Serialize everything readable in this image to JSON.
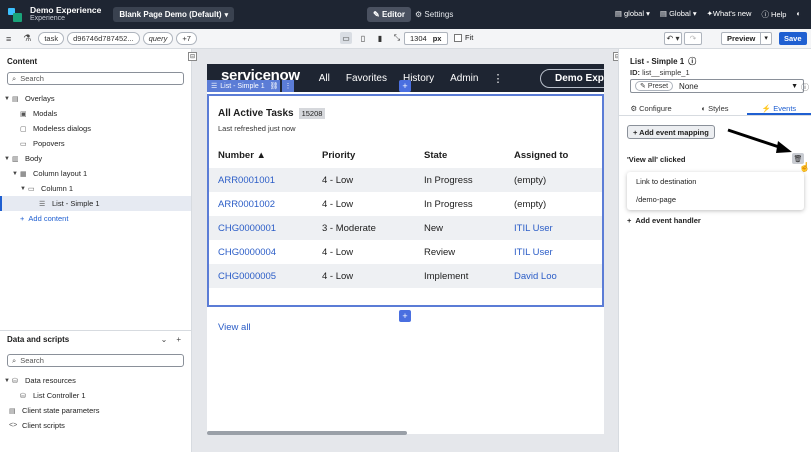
{
  "topbar": {
    "app_name": "Demo Experience",
    "app_subtitle": "Experience",
    "page_selector": "Blank Page Demo (Default)",
    "editor_label": "Editor",
    "settings_label": "Settings",
    "scope_global": "global",
    "language": "Global",
    "whats_new": "What's new",
    "help": "Help"
  },
  "toolbar": {
    "chips": [
      "task",
      "d96746d787452...",
      "query",
      "+7"
    ],
    "width_value": "1304",
    "width_unit": "px",
    "fit_label": "Fit",
    "preview_label": "Preview",
    "save_label": "Save"
  },
  "content_panel": {
    "title": "Content",
    "search_placeholder": "Search",
    "tree": {
      "overlays": "Overlays",
      "modals": "Modals",
      "modeless": "Modeless dialogs",
      "popovers": "Popovers",
      "body": "Body",
      "column_layout": "Column layout 1",
      "column": "Column 1",
      "list": "List - Simple 1",
      "add_content": "Add content"
    }
  },
  "data_panel": {
    "title": "Data and scripts",
    "search_placeholder": "Search",
    "tree": {
      "data_resources": "Data resources",
      "list_controller": "List Controller 1",
      "client_state": "Client state parameters",
      "client_scripts": "Client scripts"
    }
  },
  "canvas": {
    "sn_logo": "servicenow",
    "nav": [
      "All",
      "Favorites",
      "History",
      "Admin"
    ],
    "pill": "Demo Experience",
    "list_tag": "List - Simple 1",
    "list_title": "All Active Tasks",
    "list_count": "15208",
    "refreshed": "Last refreshed just now",
    "columns": [
      "Number ▲",
      "Priority",
      "State",
      "Assigned to"
    ],
    "rows": [
      {
        "number": "ARR0001001",
        "priority": "4 - Low",
        "state": "In Progress",
        "assigned": "(empty)",
        "assigned_link": false
      },
      {
        "number": "ARR0001002",
        "priority": "4 - Low",
        "state": "In Progress",
        "assigned": "(empty)",
        "assigned_link": false
      },
      {
        "number": "CHG0000001",
        "priority": "3 - Moderate",
        "state": "New",
        "assigned": "ITIL User",
        "assigned_link": true
      },
      {
        "number": "CHG0000004",
        "priority": "4 - Low",
        "state": "Review",
        "assigned": "ITIL User",
        "assigned_link": true
      },
      {
        "number": "CHG0000005",
        "priority": "4 - Low",
        "state": "Implement",
        "assigned": "David Loo",
        "assigned_link": true
      }
    ],
    "view_all": "View all"
  },
  "config_panel": {
    "title": "List - Simple 1",
    "id_label": "ID:",
    "id_value": "list__simple_1",
    "preset_tag": "Preset",
    "preset_value": "None",
    "tabs": [
      "Configure",
      "Styles",
      "Events"
    ],
    "active_tab": "Events",
    "add_event_mapping": "+ Add event mapping",
    "event_label": "'View all' clicked",
    "dropdown_items": [
      "Link to destination",
      "/demo-page"
    ],
    "add_event_handler": "Add event handler"
  },
  "colors": {
    "topbar_bg": "#1e2532",
    "accent_blue": "#1f5fd1",
    "link_blue": "#2b5dc7",
    "selection_outline": "#5b7cd6"
  }
}
